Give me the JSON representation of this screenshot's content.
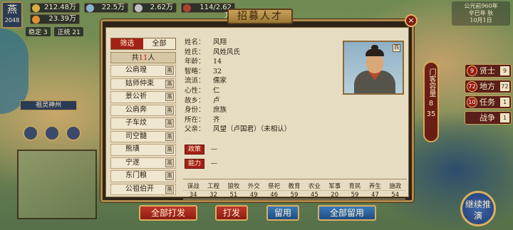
{
  "top": {
    "emblem": "燕",
    "emblem_num": "2048",
    "resources_row1": [
      {
        "value": "212.48万",
        "icon_color": "#d6b040"
      },
      {
        "value": "22.5万",
        "icon_color": "#8fb0d0"
      },
      {
        "value": "2.62万",
        "icon_color": "#c0c0c0"
      },
      {
        "value": "114/2.62万",
        "icon_color": "#b04030"
      }
    ],
    "resources_row2": [
      {
        "value": "23.39万",
        "icon_color": "#e09030"
      }
    ],
    "stats": [
      "稳定 3",
      "正统 21"
    ],
    "date_line1": "公元前960年",
    "date_line2": "辛巳年 秋",
    "date_line3": "10月1日"
  },
  "map_tag": "祖灵神州",
  "side_menu": [
    {
      "badge": "9",
      "label": "贤士",
      "count": "9"
    },
    {
      "badge": "72",
      "label": "地方",
      "count": "72"
    },
    {
      "badge": "10",
      "label": "任务",
      "count": "1"
    },
    {
      "badge": "",
      "label": "战争",
      "count": "1"
    }
  ],
  "door_bar": {
    "label": "门客容量",
    "current": "8",
    "max": "35"
  },
  "continue_label": "继续推演",
  "dialog": {
    "title": "招募人才",
    "close": "×",
    "filter": {
      "a": "筛选",
      "b": "全部"
    },
    "count_prefix": "共",
    "count_num": "11",
    "count_suffix": "人",
    "people": [
      "公肩瑝",
      "姑师仲束",
      "景公祈",
      "公肩奔",
      "子车炆",
      "司空髓",
      "熊璜",
      "宁遂",
      "东门粮",
      "公祖伯开"
    ],
    "seal": "燕",
    "fields": [
      {
        "k": "姓名：",
        "v": "风翔"
      },
      {
        "k": "姓氏：",
        "v": "风姓风氏"
      },
      {
        "k": "年龄：",
        "v": "14"
      },
      {
        "k": "智略：",
        "v": "32"
      },
      {
        "k": "流派：",
        "v": "儒家"
      },
      {
        "k": "心性：",
        "v": "仁"
      },
      {
        "k": "故乡：",
        "v": "卢"
      },
      {
        "k": "身份：",
        "v": "庶族"
      },
      {
        "k": "所在：",
        "v": "齐"
      },
      {
        "k": "父亲：",
        "v": "风望（卢国君）（未相认）"
      }
    ],
    "policy_label": "政策",
    "policy_value": "—",
    "ability_label": "能力",
    "ability_value": "—",
    "skills_header": [
      "谋战",
      "工程",
      "狼牧",
      "外交",
      "祭祀",
      "教育",
      "农业",
      "军事",
      "育民",
      "养生",
      "施政"
    ],
    "skills_values": [
      "34",
      "32",
      "51",
      "49",
      "46",
      "59",
      "45",
      "20",
      "59",
      "47",
      "54"
    ]
  },
  "buttons": {
    "dismiss_all": "全部打发",
    "dismiss": "打发",
    "keep": "留用",
    "keep_all": "全部留用"
  }
}
